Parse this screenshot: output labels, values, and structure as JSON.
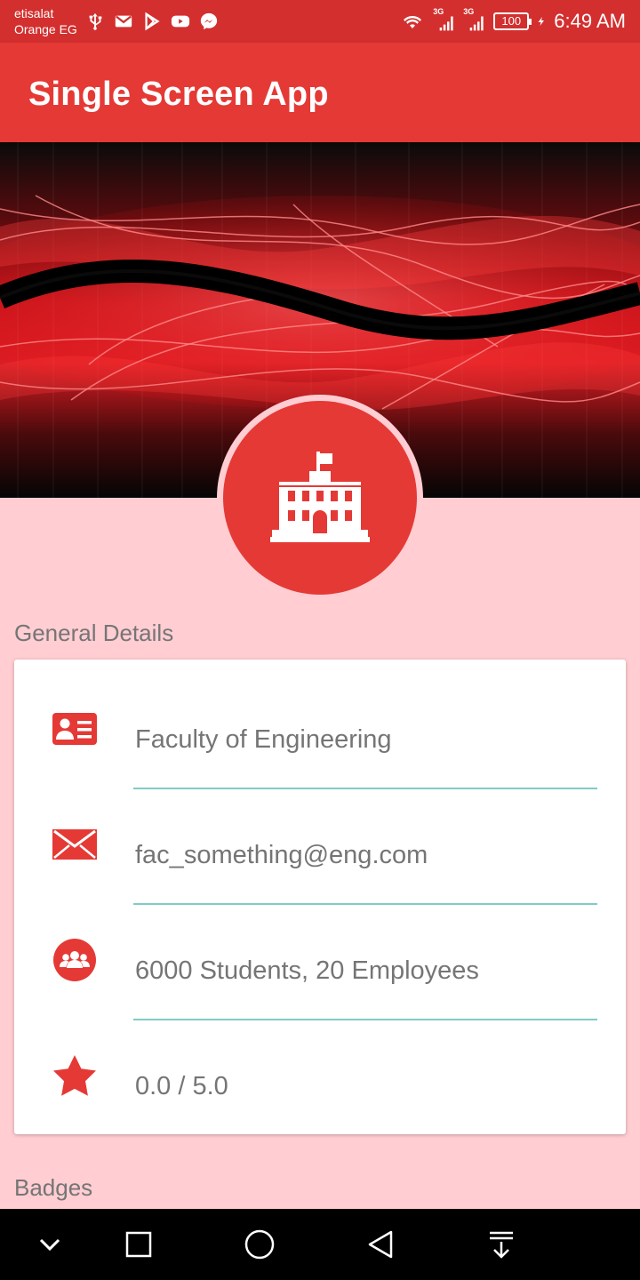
{
  "status_bar": {
    "carrier_line1": "etisalat",
    "carrier_line2": "Orange EG",
    "left_icons": [
      "usb-icon",
      "gmail-icon",
      "play-store-icon",
      "youtube-icon",
      "messenger-icon"
    ],
    "right_icons": [
      "wifi-icon",
      "signal-3g-icon",
      "signal-3g-icon",
      "battery-icon",
      "charging-icon"
    ],
    "network_label_1": "3G",
    "network_label_2": "3G",
    "battery_level": "100",
    "time": "6:49 AM"
  },
  "app_bar": {
    "title": "Single Screen App"
  },
  "header": {
    "image": "red-abstract-wave-banner",
    "avatar_icon": "university-building-icon"
  },
  "general_details": {
    "section_title": "General Details",
    "rows": [
      {
        "icon": "id-card-icon",
        "text": "Faculty of Engineering"
      },
      {
        "icon": "envelope-icon",
        "text": "fac_something@eng.com"
      },
      {
        "icon": "group-icon",
        "text": "6000 Students, 20 Employees"
      },
      {
        "icon": "star-icon",
        "text": "0.0 / 5.0"
      }
    ]
  },
  "badges": {
    "section_title": "Badges"
  },
  "nav_bar": {
    "buttons": [
      "collapse-chevron-icon",
      "recent-apps-icon",
      "home-icon",
      "back-icon",
      "notifications-pull-icon"
    ]
  },
  "colors": {
    "status_bar": "#d32f2f",
    "app_bar": "#e53935",
    "accent": "#e53935",
    "background": "#ffcdd2",
    "divider": "#80cbc4",
    "text_secondary": "#757575"
  }
}
